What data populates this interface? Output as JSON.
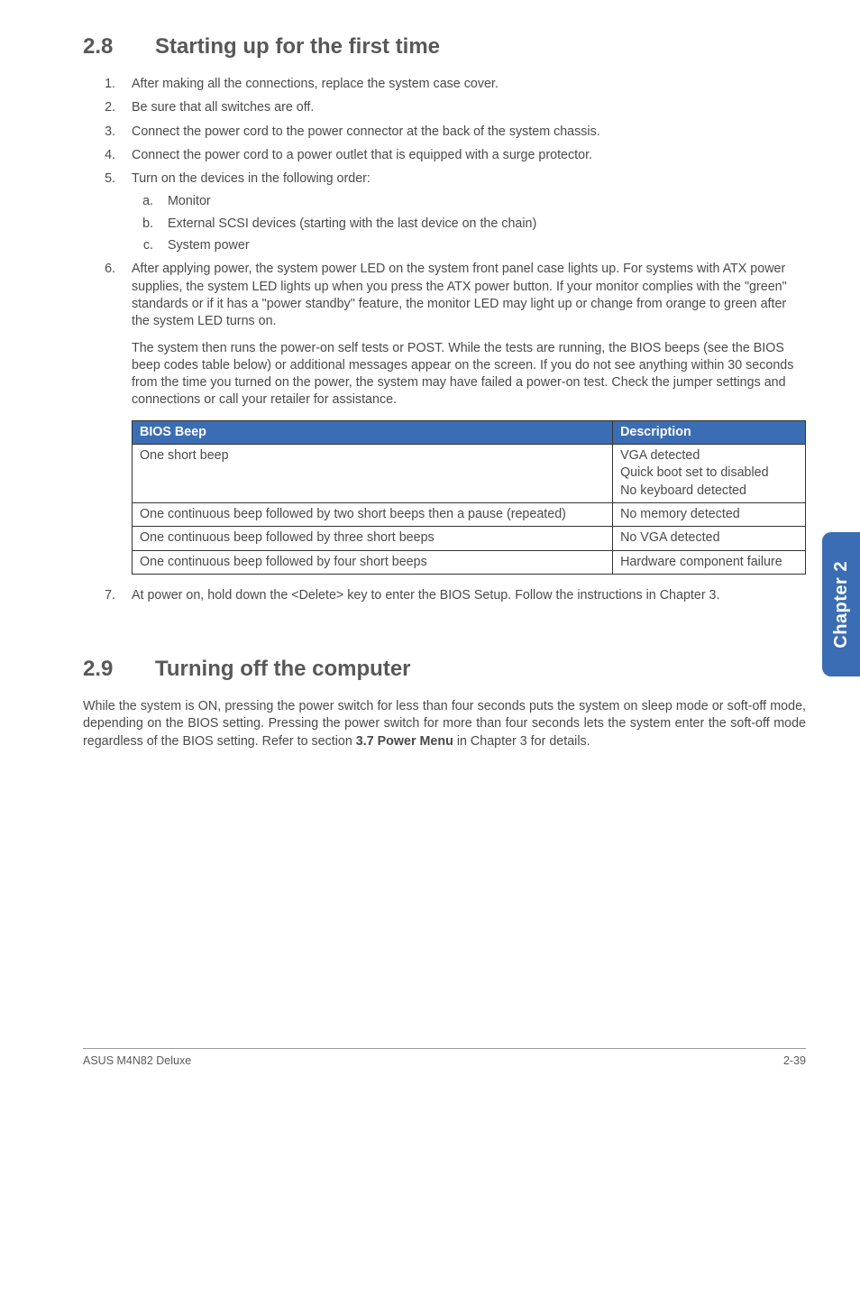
{
  "side_tab": "Chapter 2",
  "section28": {
    "num": "2.8",
    "title": "Starting up for the first time",
    "steps": [
      "After making all the connections, replace the system case cover.",
      "Be sure that all switches are off.",
      "Connect the power cord to the power connector at the back of the system chassis.",
      "Connect the power cord to a power outlet that is equipped with a surge protector.",
      "Turn on the devices in the following order:",
      "After applying power, the system power LED on the system front panel case lights up. For systems with ATX power supplies, the system LED lights up when you press the ATX power button. If your monitor complies with the \"green\" standards or if it has a \"power standby\" feature, the monitor LED may light up or change from orange to green after the system LED turns on."
    ],
    "sub5": [
      "Monitor",
      "External SCSI devices (starting with the last device on the chain)",
      "System power"
    ],
    "para6b": "The system then runs the power-on self tests or POST. While the tests are running, the BIOS beeps (see the BIOS beep codes table below) or additional messages appear on the screen. If you do not see anything within 30 seconds from the time you turned on the power, the system may have failed a power-on test. Check the jumper settings and connections or call your retailer for assistance.",
    "table": {
      "head1": "BIOS Beep",
      "head2": "Description",
      "rows": [
        {
          "beep": "One short beep",
          "desc": "VGA detected\nQuick boot set to disabled\nNo keyboard detected"
        },
        {
          "beep": "One continuous beep followed by two short beeps then a pause (repeated)",
          "desc": "No memory detected"
        },
        {
          "beep": "One continuous beep followed by three short beeps",
          "desc": "No VGA detected"
        },
        {
          "beep": "One continuous beep followed by four short beeps",
          "desc": "Hardware component failure"
        }
      ]
    },
    "step7": "At power on, hold down the <Delete> key to enter the BIOS Setup. Follow the instructions in Chapter 3."
  },
  "section29": {
    "num": "2.9",
    "title": "Turning off the computer",
    "body_pre": "While the system is ON, pressing the power switch for less than four seconds puts the system on sleep mode or soft-off mode, depending on the BIOS setting. Pressing the power switch for more than four seconds lets the system enter the soft-off mode regardless of the BIOS setting. Refer to section ",
    "body_bold": "3.7 Power Menu",
    "body_post": " in Chapter 3 for details."
  },
  "footer": {
    "left": "ASUS M4N82 Deluxe",
    "right": "2-39"
  }
}
